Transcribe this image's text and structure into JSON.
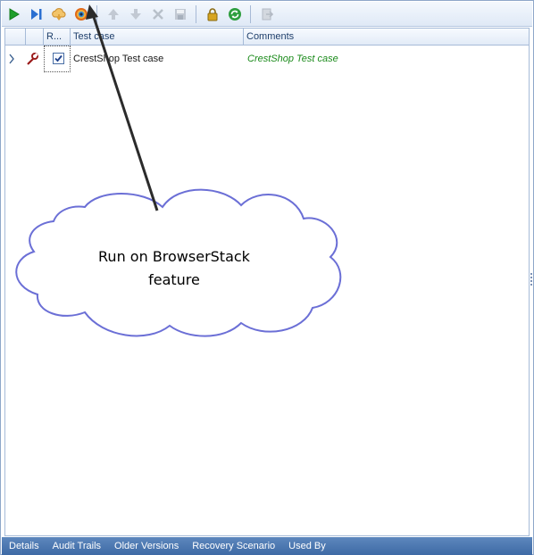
{
  "toolbar": {
    "buttons": [
      {
        "name": "run-icon",
        "color": "#1e9e2a"
      },
      {
        "name": "run-next-icon",
        "color": "#2a6fd1"
      },
      {
        "name": "cloud-run-icon",
        "color": "#e0a23a"
      },
      {
        "name": "browserstack-icon",
        "color": "#e06a1a"
      },
      {
        "name": "move-up-icon",
        "color": "#b8c0ca"
      },
      {
        "name": "move-down-icon",
        "color": "#b8c0ca"
      },
      {
        "name": "delete-icon",
        "color": "#b8c0ca"
      },
      {
        "name": "save-icon",
        "color": "#b8c0ca"
      },
      {
        "name": "lock-icon",
        "color": "#d7a520"
      },
      {
        "name": "refresh-icon",
        "color": "#2e9e3e"
      },
      {
        "name": "export-icon",
        "color": "#b8c0ca"
      }
    ]
  },
  "grid": {
    "columns": {
      "run": "R...",
      "test_case": "Test case",
      "comments": "Comments"
    },
    "rows": [
      {
        "test_case": "CrestShop Test case",
        "comments": "CrestShop Test case",
        "checked": true
      }
    ]
  },
  "annotation": {
    "line1": "Run on BrowserStack",
    "line2": "feature"
  },
  "bottom_tabs": [
    "Details",
    "Audit Trails",
    "Older Versions",
    "Recovery Scenario",
    "Used By"
  ],
  "colors": {
    "comment_text": "#1a8a1a",
    "cloud_outline": "#6b6fd6",
    "tab_bar": "#4a76b0"
  }
}
